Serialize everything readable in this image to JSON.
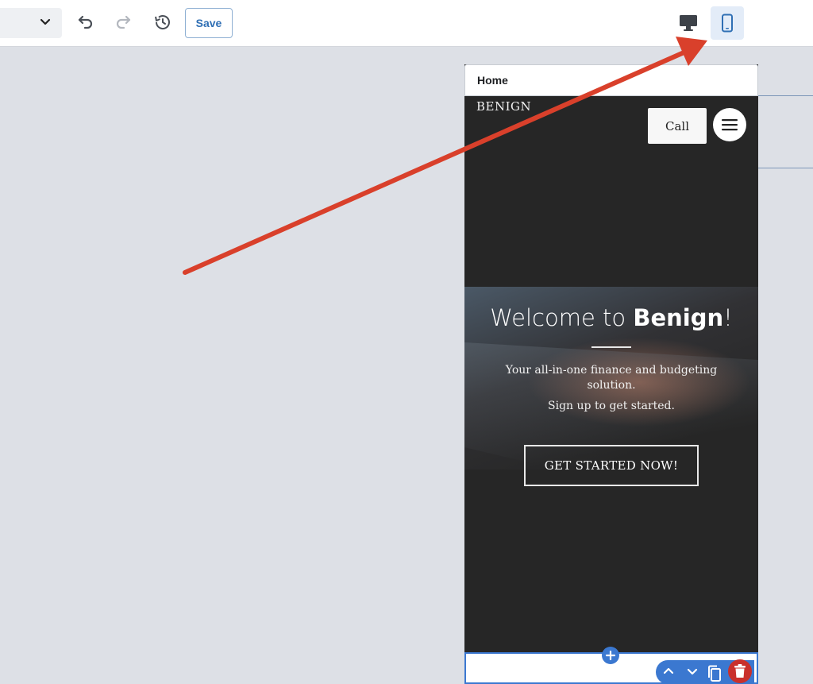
{
  "toolbar": {
    "dropdown_icon": "chevron-down-icon",
    "undo_icon": "undo-icon",
    "redo_icon": "redo-icon",
    "history_icon": "history-icon",
    "save_label": "Save",
    "desktop_icon": "desktop-icon",
    "mobile_icon": "mobile-icon",
    "accent": "#2f6fb4"
  },
  "preview": {
    "page_name": "Home",
    "logo": "BENIGN",
    "call_label": "Call",
    "menu_icon": "hamburger-icon",
    "welcome_prefix": "Welcome to ",
    "welcome_brand": "Benign",
    "welcome_suffix": "!",
    "subtitle": "Your all-in-one finance and budgeting solution.",
    "signup": "Sign up to get started.",
    "cta_label": "GET STARTED NOW!"
  },
  "section_tools": {
    "add_icon": "plus-icon",
    "move_up_icon": "chevron-up-icon",
    "move_down_icon": "chevron-down-icon",
    "duplicate_icon": "copy-icon",
    "delete_icon": "trash-icon",
    "accent": "#3b78d0",
    "danger": "#c9302c"
  },
  "annotation": {
    "arrow_color": "#d9402b"
  }
}
